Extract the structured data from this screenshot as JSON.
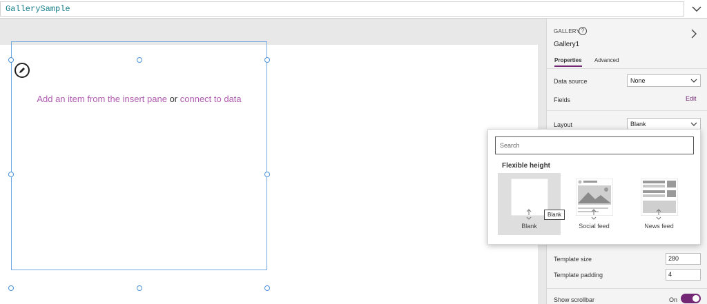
{
  "formula_bar": {
    "value": "GallerySample"
  },
  "canvas": {
    "empty_message": {
      "part1": "Add an item from the insert pane",
      "or": "or",
      "link": "connect to data"
    }
  },
  "pane": {
    "type_label": "GALLERY",
    "control_name": "Gallery1",
    "tabs": [
      {
        "label": "Properties",
        "active": true
      },
      {
        "label": "Advanced",
        "active": false
      }
    ],
    "data_source": {
      "label": "Data source",
      "value": "None"
    },
    "fields": {
      "label": "Fields",
      "action": "Edit"
    },
    "layout": {
      "label": "Layout",
      "value": "Blank"
    },
    "template_size": {
      "label": "Template size",
      "value": "280"
    },
    "template_padding": {
      "label": "Template padding",
      "value": "4"
    },
    "show_scrollbar": {
      "label": "Show scrollbar",
      "state": "On"
    }
  },
  "flyout": {
    "search_placeholder": "Search",
    "heading": "Flexible height",
    "layouts": [
      {
        "label": "Blank"
      },
      {
        "label": "Social feed"
      },
      {
        "label": "News feed"
      }
    ],
    "tooltip": "Blank"
  },
  "colors": {
    "accent": "#742774",
    "link": "#b05cb0",
    "selection": "#6fa8e0"
  }
}
